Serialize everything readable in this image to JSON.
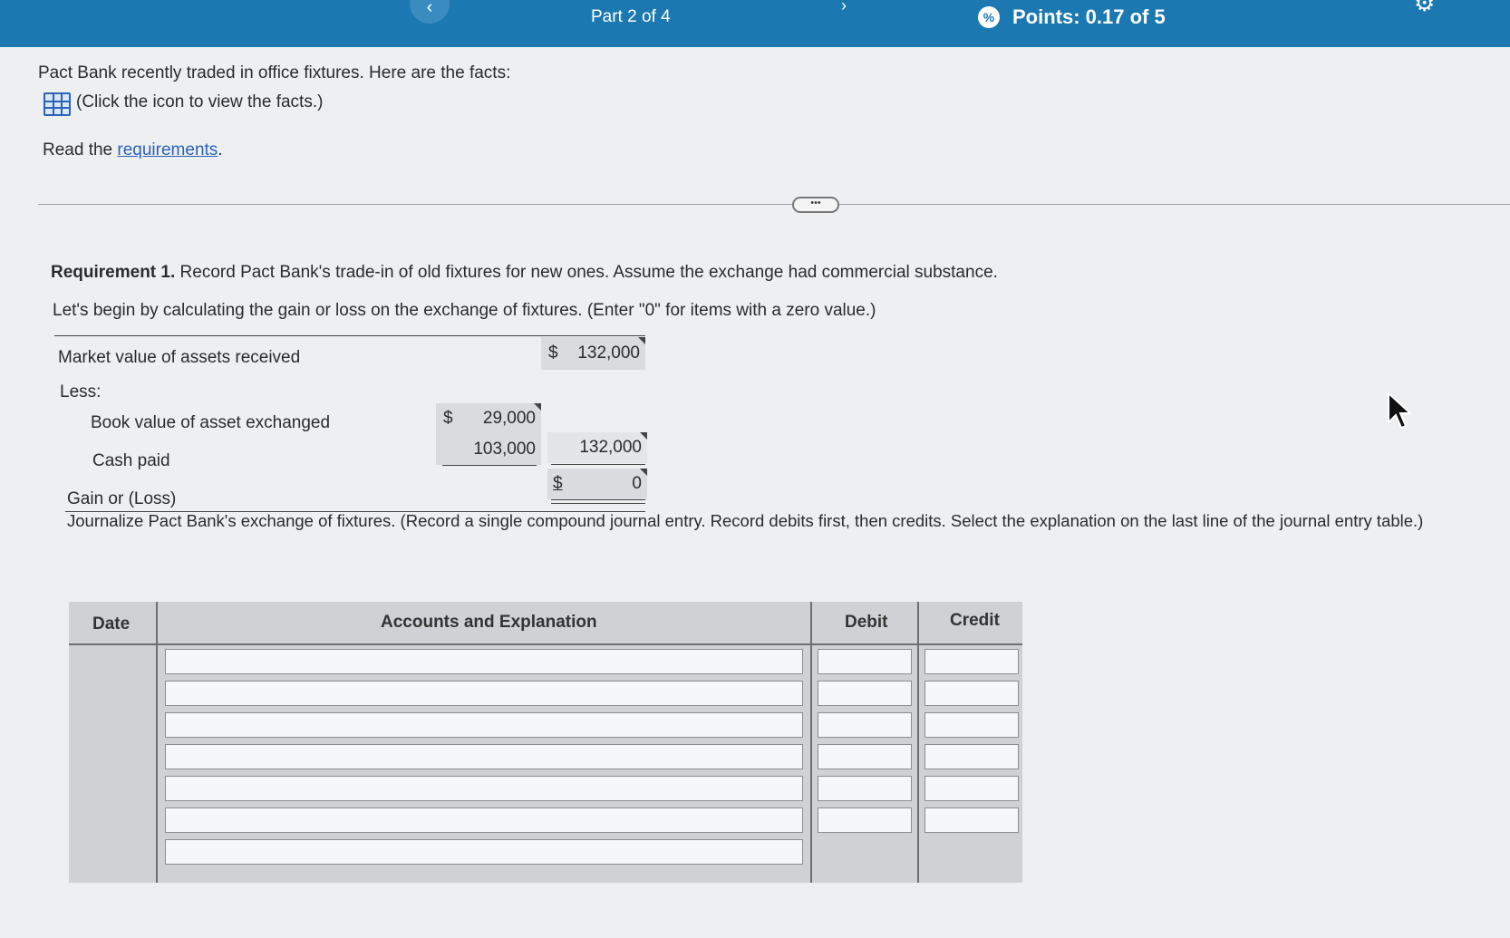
{
  "header": {
    "part_label": "Part 2 of 4",
    "points_label": "Points: 0.17 of 5",
    "points_icon": "%"
  },
  "intro": {
    "facts_line": "Pact Bank recently traded in office fixtures. Here are the facts:",
    "facts_link": "(Click the icon to view the facts.)",
    "read_prefix": "Read the ",
    "requirements_link": "requirements",
    "read_suffix": "."
  },
  "requirement": {
    "label": "Requirement 1.",
    "text": " Record Pact Bank's trade-in of old fixtures for new ones. Assume the exchange had commercial substance.",
    "instruction": "Let's begin by calculating the gain or loss on the exchange of fixtures. (Enter \"0\" for items with a zero value.)"
  },
  "calc": {
    "market_value_label": "Market value of assets received",
    "market_value": "132,000",
    "less_label": "Less:",
    "book_value_label": "Book value of asset exchanged",
    "book_value": "29,000",
    "cash_paid_label": "Cash paid",
    "cash_paid": "103,000",
    "subtotal": "132,000",
    "gain_label": "Gain or (Loss)",
    "gain_value": "0",
    "currency": "$"
  },
  "journal": {
    "instruction": "Journalize Pact Bank's exchange of fixtures. (Record a single compound journal entry. Record debits first, then credits. Select the explanation on the last line of the journal entry table.)",
    "col_date": "Date",
    "col_accounts": "Accounts and Explanation",
    "col_debit": "Debit",
    "col_credit": "Credit"
  }
}
